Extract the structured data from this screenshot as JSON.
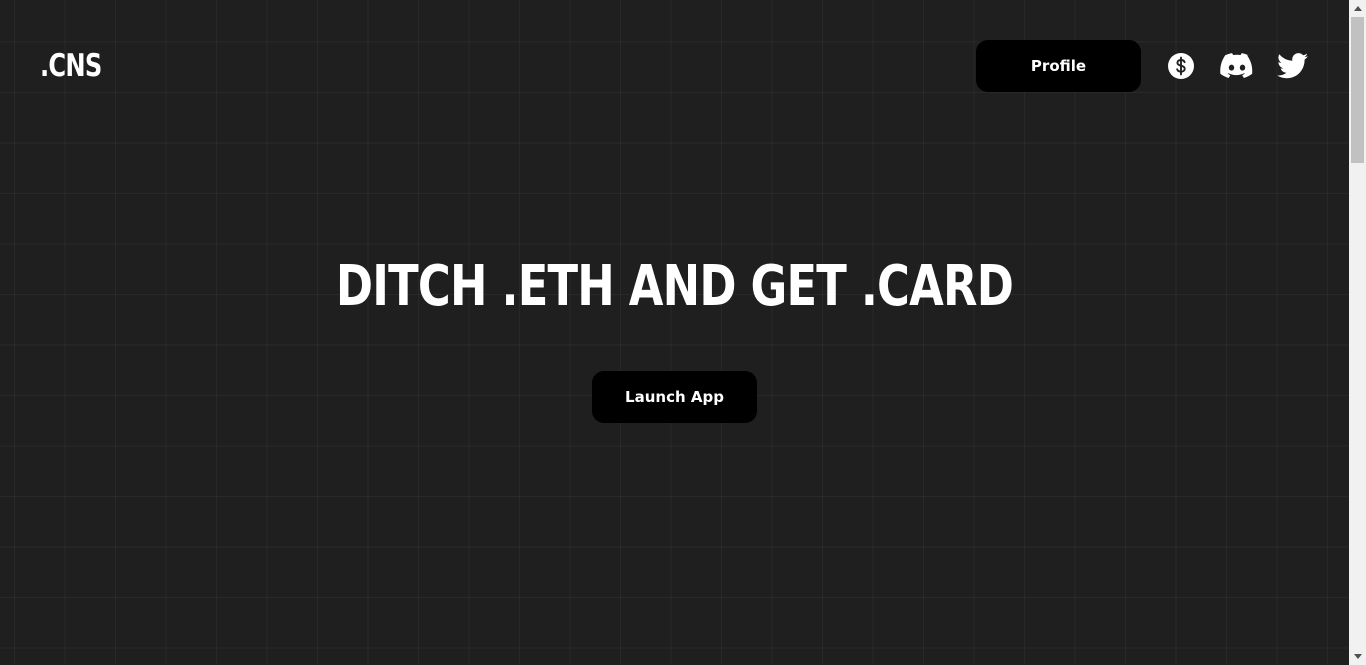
{
  "header": {
    "logo": ".CNS",
    "profile_label": "Profile",
    "icons": [
      "dollar-icon",
      "discord-icon",
      "twitter-icon"
    ]
  },
  "hero": {
    "title": "DITCH .ETH AND GET .CARD",
    "launch_label": "Launch App"
  },
  "colors": {
    "background": "#202020",
    "button": "#000000",
    "text": "#ffffff"
  }
}
